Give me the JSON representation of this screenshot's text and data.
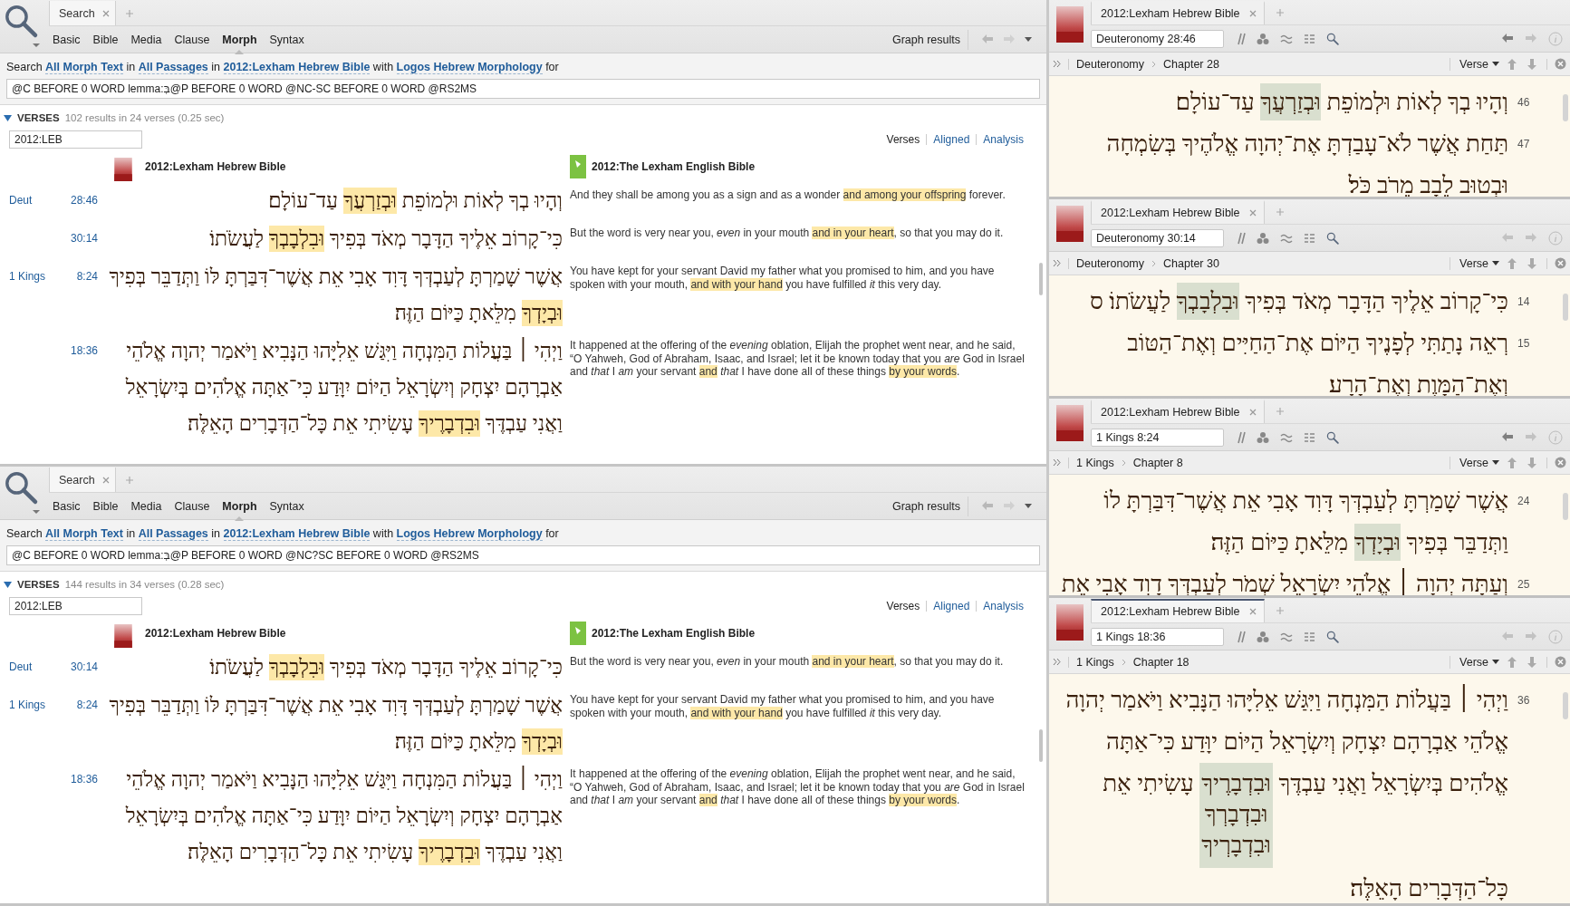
{
  "search_panes": [
    {
      "tabs": [
        {
          "label": "Search",
          "selected": true
        }
      ],
      "search_types": [
        {
          "label": "Basic",
          "selected": false
        },
        {
          "label": "Bible",
          "selected": false
        },
        {
          "label": "Media",
          "selected": false
        },
        {
          "label": "Clause",
          "selected": false
        },
        {
          "label": "Morph",
          "selected": true
        },
        {
          "label": "Syntax",
          "selected": false
        }
      ],
      "graph_button": "Graph results",
      "description": [
        {
          "kind": "plain",
          "text": "Search "
        },
        {
          "kind": "link",
          "text": "All Morph Text"
        },
        {
          "kind": "plain",
          "text": " in "
        },
        {
          "kind": "link",
          "text": "All Passages"
        },
        {
          "kind": "plain",
          "text": " in "
        },
        {
          "kind": "link",
          "text": "2012:Lexham Hebrew Bible"
        },
        {
          "kind": "plain",
          "text": " with "
        },
        {
          "kind": "link",
          "text": "Logos Hebrew Morphology"
        },
        {
          "kind": "plain",
          "text": " for"
        }
      ],
      "query": "@C BEFORE 0 WORD lemma:בְּ@P BEFORE 0 WORD @NC-SC BEFORE 0 WORD @RS2MS",
      "results": {
        "title": "VERSES",
        "expanded": true,
        "summary": "102 results in 24 verses (0.25 sec)",
        "filter": "2012:LEB",
        "views": [
          {
            "label": "Verses",
            "selected": true
          },
          {
            "label": "Aligned",
            "selected": false
          },
          {
            "label": "Analysis",
            "selected": false
          }
        ],
        "columns": [
          "2012:Lexham Hebrew Bible",
          "2012:The Lexham English Bible"
        ],
        "rows": [
          {
            "book": "Deut",
            "ref": "28:46",
            "hebrew": [
              {
                "text": "וְהָיוּ בְךָ לְאוֹת וּלְמוֹפֵת ",
                "highlighted": false
              },
              {
                "text": "וּבְזַרְעֲךָ",
                "highlighted": true
              },
              {
                "text": " עַד־עוֹלָם׃",
                "highlighted": false
              }
            ],
            "english": [
              {
                "text": "And they shall be among you as a sign and as a wonder ",
                "highlighted": false
              },
              {
                "text": "and among your offspring",
                "highlighted": true
              },
              {
                "text": " forever.",
                "highlighted": false
              }
            ]
          },
          {
            "ref": "30:14",
            "hebrew": [
              {
                "text": "כִּי־קָרוֹב אֵלֶיךָ הַדָּבָר מְאֹד בְּפִיךָ ",
                "highlighted": false
              },
              {
                "text": "וּבִלְבָבְךָ",
                "highlighted": true
              },
              {
                "text": " לַעֲשֹׂתוֹ׃",
                "highlighted": false
              }
            ],
            "english": [
              {
                "text": "But the word is very near you, *even* in your mouth ",
                "highlighted": false
              },
              {
                "text": "and in your heart",
                "highlighted": true
              },
              {
                "text": ", so that you may do it.",
                "highlighted": false
              }
            ]
          },
          {
            "book": "1 Kings",
            "ref": "8:24",
            "hebrew": [
              {
                "text": "אֲשֶׁר שָׁמַרְתָּ לְעַבְדְּךָ דָּוִד אָבִי אֵת אֲשֶׁר־דִּבַּרְתָּ לּוֹ וַתְּדַבֵּר בְּפִיךָ ",
                "highlighted": false
              },
              {
                "text": "וּבְיָדְךָ",
                "highlighted": true
              },
              {
                "text": " מִלֵּאתָ כַּיּוֹם הַזֶּה׃",
                "highlighted": false
              }
            ],
            "english": [
              {
                "text": "You have kept for your servant David my father what you promised to him, and you have spoken with your mouth, ",
                "highlighted": false
              },
              {
                "text": "and with your hand",
                "highlighted": true
              },
              {
                "text": " you have fulfilled *it* this very day.",
                "highlighted": false
              }
            ]
          },
          {
            "ref": "18:36",
            "hebrew": [
              {
                "text": "וַיְהִי ׀ בַּעֲלוֹת הַמִּנְחָה וַיִּגַּשׁ אֵלִיָּהוּ הַנָּבִיא וַיֹּאמַר יְהוָה אֱלֹהֵי אַבְרָהָם יִצְחָק וְיִשְׂרָאֵל הַיּוֹם יִוָּדַע כִּי־אַתָּה אֱלֹהִים בְּיִשְׂרָאֵל וַאֲנִי עַבְדֶּךָ ",
                "highlighted": false
              },
              {
                "text": "וּבִדְבָרֶיךָ",
                "highlighted": true
              },
              {
                "text": " עָשִׂיתִי אֵת כָּל־הַדְּבָרִים הָאֵלֶּה׃",
                "highlighted": false
              }
            ],
            "english": [
              {
                "text": "It happened at the offering of the *evening* oblation, Elijah the prophet went near, and he said, “O Yahweh, God of Abraham, Isaac, and Israel; let it be known today that you *are* God in Israel and *that* I *am* your servant ",
                "highlighted": false
              },
              {
                "text": "and",
                "highlighted": true
              },
              {
                "text": " *that* I have done all of these things ",
                "highlighted": false
              },
              {
                "text": "by your words",
                "highlighted": true
              },
              {
                "text": ".",
                "highlighted": false
              }
            ]
          }
        ]
      }
    },
    {
      "tabs": [
        {
          "label": "Search",
          "selected": true
        }
      ],
      "search_types": [
        {
          "label": "Basic",
          "selected": false
        },
        {
          "label": "Bible",
          "selected": false
        },
        {
          "label": "Media",
          "selected": false
        },
        {
          "label": "Clause",
          "selected": false
        },
        {
          "label": "Morph",
          "selected": true
        },
        {
          "label": "Syntax",
          "selected": false
        }
      ],
      "graph_button": "Graph results",
      "description": [
        {
          "kind": "plain",
          "text": "Search "
        },
        {
          "kind": "link",
          "text": "All Morph Text"
        },
        {
          "kind": "plain",
          "text": " in "
        },
        {
          "kind": "link",
          "text": "All Passages"
        },
        {
          "kind": "plain",
          "text": " in "
        },
        {
          "kind": "link",
          "text": "2012:Lexham Hebrew Bible"
        },
        {
          "kind": "plain",
          "text": " with "
        },
        {
          "kind": "link",
          "text": "Logos Hebrew Morphology"
        },
        {
          "kind": "plain",
          "text": " for"
        }
      ],
      "query": "@C BEFORE 0 WORD lemma:בְּ@P BEFORE 0 WORD @NC?SC BEFORE 0 WORD @RS2MS",
      "results": {
        "title": "VERSES",
        "expanded": true,
        "summary": "144 results in 34 verses (0.28 sec)",
        "filter": "2012:LEB",
        "views": [
          {
            "label": "Verses",
            "selected": true
          },
          {
            "label": "Aligned",
            "selected": false
          },
          {
            "label": "Analysis",
            "selected": false
          }
        ],
        "columns": [
          "2012:Lexham Hebrew Bible",
          "2012:The Lexham English Bible"
        ],
        "rows": [
          {
            "book": "Deut",
            "ref": "30:14",
            "hebrew": [
              {
                "text": "כִּי־קָרוֹב אֵלֶיךָ הַדָּבָר מְאֹד בְּפִיךָ ",
                "highlighted": false
              },
              {
                "text": "וּבִלְבָבְךָ",
                "highlighted": true
              },
              {
                "text": " לַעֲשֹׂתוֹ׃",
                "highlighted": false
              }
            ],
            "english": [
              {
                "text": "But the word is very near you, *even* in your mouth ",
                "highlighted": false
              },
              {
                "text": "and in your heart",
                "highlighted": true
              },
              {
                "text": ", so that you may do it.",
                "highlighted": false
              }
            ]
          },
          {
            "book": "1 Kings",
            "ref": "8:24",
            "hebrew": [
              {
                "text": "אֲשֶׁר שָׁמַרְתָּ לְעַבְדְּךָ דָּוִד אָבִי אֵת אֲשֶׁר־דִּבַּרְתָּ לּוֹ וַתְּדַבֵּר בְּפִיךָ ",
                "highlighted": false
              },
              {
                "text": "וּבְיָדְךָ",
                "highlighted": true
              },
              {
                "text": " מִלֵּאתָ כַּיּוֹם הַזֶּה׃",
                "highlighted": false
              }
            ],
            "english": [
              {
                "text": "You have kept for your servant David my father what you promised to him, and you have spoken with your mouth, ",
                "highlighted": false
              },
              {
                "text": "and with your hand",
                "highlighted": true
              },
              {
                "text": " you have fulfilled *it* this very day.",
                "highlighted": false
              }
            ]
          },
          {
            "ref": "18:36",
            "hebrew": [
              {
                "text": "וַיְהִי ׀ בַּעֲלוֹת הַמִּנְחָה וַיִּגַּשׁ אֵלִיָּהוּ הַנָּבִיא וַיֹּאמַר יְהוָה אֱלֹהֵי אַבְרָהָם יִצְחָק וְיִשְׂרָאֵל הַיּוֹם יִוָּדַע כִּי־אַתָּה אֱלֹהִים בְּיִשְׂרָאֵל וַאֲנִי עַבְדֶּךָ ",
                "highlighted": false
              },
              {
                "text": "וּבִדְבָרֶיךָ",
                "highlighted": true
              },
              {
                "text": " עָשִׂיתִי אֵת כָּל־הַדְּבָרִים הָאֵלֶּה׃",
                "highlighted": false
              }
            ],
            "english": [
              {
                "text": "It happened at the offering of the *evening* oblation, Elijah the prophet went near, and he said, “O Yahweh, God of Abraham, Isaac, and Israel; let it be known today that you *are* God in Israel and *that* I *am* your servant ",
                "highlighted": false
              },
              {
                "text": "and",
                "highlighted": true
              },
              {
                "text": " *that* I have done all of these things ",
                "highlighted": false
              },
              {
                "text": "by your words",
                "highlighted": true
              },
              {
                "text": ".",
                "highlighted": false
              }
            ]
          }
        ]
      }
    }
  ],
  "reader_panes": [
    {
      "tab": {
        "label": "2012:Lexham Hebrew Bible",
        "selected": false
      },
      "reference": "Deuteronomy 28:46",
      "back_enabled": true,
      "breadcrumb": [
        "Deuteronomy",
        "Chapter 28"
      ],
      "view": "Verse",
      "verses": [
        {
          "number": "46",
          "segments": [
            {
              "kind": "text",
              "text": "וְהָיוּ בְךָ לְאוֹת וּלְמוֹפֵת "
            },
            {
              "kind": "hit",
              "text": "וּבְזַרְעֲךָ"
            },
            {
              "kind": "text",
              "text": " עַד־עוֹלָם׃"
            }
          ]
        },
        {
          "number": "47",
          "segments": [
            {
              "kind": "text",
              "text": "תַּחַת אֲשֶׁר לֹא־עָבַדְתָּ אֶת־יְהוָה אֱלֹהֶיךָ בְּשִׂמְחָה וּבְטוּב לֵבָב מֵרֹב כֹּל׃"
            }
          ]
        }
      ]
    },
    {
      "tab": {
        "label": "2012:Lexham Hebrew Bible",
        "selected": false
      },
      "reference": "Deuteronomy 30:14",
      "back_enabled": false,
      "breadcrumb": [
        "Deuteronomy",
        "Chapter 30"
      ],
      "view": "Verse",
      "verses": [
        {
          "number": "14",
          "segments": [
            {
              "kind": "text",
              "text": "כִּי־קָרוֹב אֵלֶיךָ הַדָּבָר מְאֹד בְּפִיךָ "
            },
            {
              "kind": "hit",
              "text": "וּבִלְבָבְךָ"
            },
            {
              "kind": "text",
              "text": " לַעֲשֹׂתוֹ׃ ס"
            }
          ]
        },
        {
          "number": "15",
          "segments": [
            {
              "kind": "text",
              "text": "רְאֵה נָתַתִּי לְפָנֶיךָ הַיּוֹם אֶת־הַחַיִּים וְאֶת־הַטּוֹב וְאֶת־הַמָּוֶת וְאֶת־הָרָע׃"
            }
          ]
        }
      ]
    },
    {
      "tab": {
        "label": "2012:Lexham Hebrew Bible",
        "selected": false
      },
      "reference": "1 Kings 8:24",
      "back_enabled": true,
      "breadcrumb": [
        "1 Kings",
        "Chapter 8"
      ],
      "view": "Verse",
      "verses": [
        {
          "number": "24",
          "segments": [
            {
              "kind": "text",
              "text": "אֲשֶׁר שָׁמַרְתָּ לְעַבְדְּךָ דָּוִד אָבִי אֵת אֲשֶׁר־דִּבַּרְתָּ לוֹ וַתְּדַבֵּר בְּפִיךָ "
            },
            {
              "kind": "hit",
              "text": "וּבְיָדְךָ"
            },
            {
              "kind": "text",
              "text": " מִלֵּאתָ כַּיּוֹם הַזֶּה׃"
            }
          ]
        },
        {
          "number": "25",
          "segments": [
            {
              "kind": "text",
              "text": "וְעַתָּה יְהוָה ׀ אֱלֹהֵי יִשְׂרָאֵל שְׁמֹר לְעַבְדְּךָ דָוִד אָבִי אֵת"
            }
          ]
        }
      ]
    },
    {
      "tab": {
        "label": "2012:Lexham Hebrew Bible",
        "selected": true
      },
      "reference": "1 Kings 18:36",
      "back_enabled": false,
      "breadcrumb": [
        "1 Kings",
        "Chapter 18"
      ],
      "view": "Verse",
      "verses": [
        {
          "number": "36",
          "segments": [
            {
              "kind": "text",
              "text": "וַיְהִי ׀ בַּעֲלוֹת הַמִּנְחָה וַיִּגַּשׁ אֵלִיָּהוּ הַנָּבִיא וַיֹּאמַר יְהוָה אֱלֹהֵי אַבְרָהָם יִצְחָק וְיִשְׂרָאֵל הַיּוֹם יוָּדַע כִּי־אַתָּה אֱלֹהִים בְּיִשְׂרָאֵל וַאֲנִי עַבְדֶּךָ "
            },
            {
              "kind": "variants",
              "options": [
                "וּבִדְבָרֶיךָ",
                "וּבִדְבָרְךָ",
                "וּבִדְבָרְיךָ"
              ]
            },
            {
              "kind": "text",
              "text": " עָשִׂיתִי אֵת כָּל־הַדְּבָרִים הָאֵלֶּה׃"
            }
          ]
        }
      ]
    }
  ]
}
